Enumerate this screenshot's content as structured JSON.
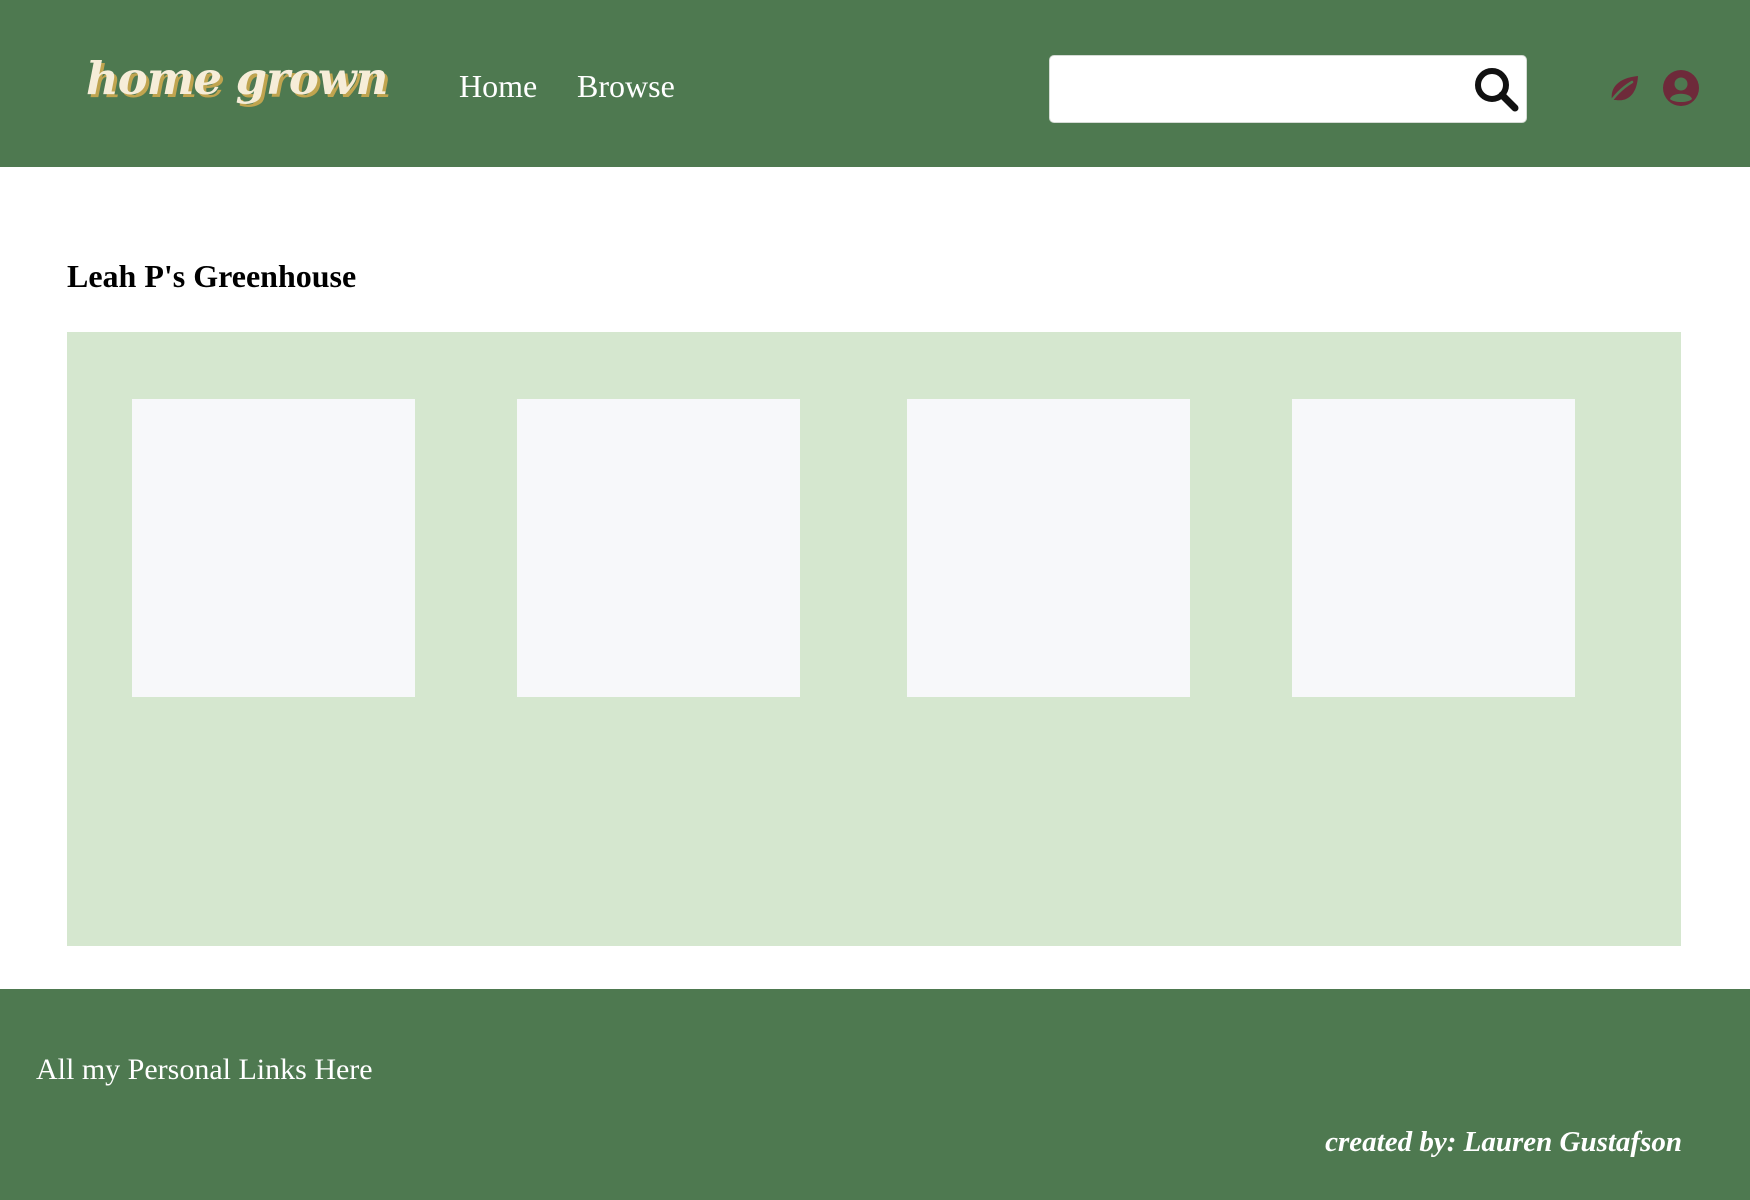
{
  "header": {
    "logo": "home grown",
    "nav": {
      "home_label": "Home",
      "browse_label": "Browse"
    },
    "search": {
      "value": "",
      "placeholder": "",
      "icon": "search-icon"
    },
    "icons": {
      "garden": "leaf-icon",
      "account": "user-icon"
    }
  },
  "main": {
    "title": "Leah P's Greenhouse",
    "cards_count_visible": 4
  },
  "footer": {
    "links_text": "All my Personal Links Here",
    "credit": "created by: Lauren Gustafson"
  },
  "colors": {
    "brand_green": "#4e7950",
    "panel_green": "#d5e7cf",
    "card_bg": "#f7f8fa",
    "icon_maroon": "#6e2a3a",
    "logo_cream": "#f6edd8",
    "logo_shadow": "#c0a44f"
  }
}
